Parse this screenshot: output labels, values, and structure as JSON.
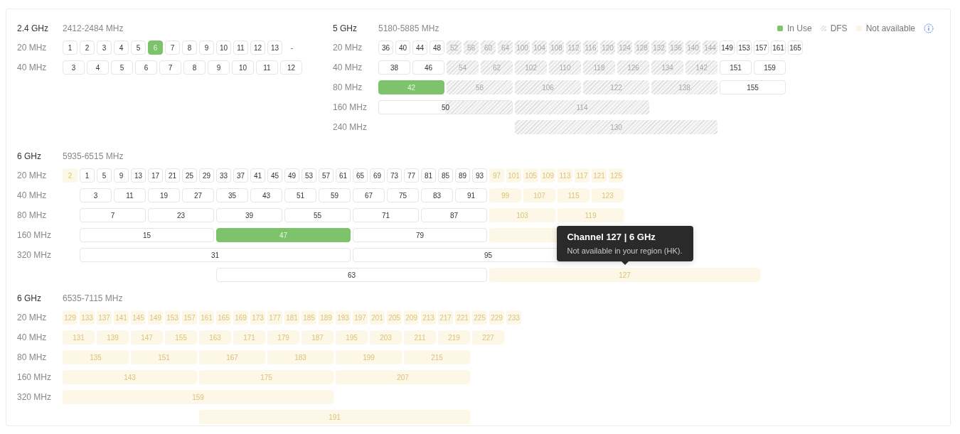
{
  "legend": [
    {
      "kind": "in_use",
      "label": "In Use"
    },
    {
      "kind": "dfs",
      "label": "DFS"
    },
    {
      "kind": "unavailable",
      "label": "Not available"
    }
  ],
  "bands": [
    {
      "name": "2.4 GHz",
      "range": "2412-2484 MHz",
      "kind": "sequential",
      "rows": [
        {
          "label": "20 MHz",
          "lines": [
            [
              {
                "ch": "1",
                "kind": "available"
              },
              {
                "ch": "2",
                "kind": "available"
              },
              {
                "ch": "3",
                "kind": "available"
              },
              {
                "ch": "4",
                "kind": "available"
              },
              {
                "ch": "5",
                "kind": "available"
              },
              {
                "ch": "6",
                "kind": "in_use"
              },
              {
                "ch": "7",
                "kind": "available"
              },
              {
                "ch": "8",
                "kind": "available"
              },
              {
                "ch": "9",
                "kind": "available"
              },
              {
                "ch": "10",
                "kind": "available"
              },
              {
                "ch": "11",
                "kind": "available"
              },
              {
                "ch": "12",
                "kind": "available"
              },
              {
                "ch": "13",
                "kind": "available"
              },
              {
                "ch": "-",
                "kind": "blank"
              }
            ]
          ]
        },
        {
          "label": "40 MHz",
          "lines": [
            [
              {
                "ch": "3",
                "kind": "available"
              },
              {
                "ch": "4",
                "kind": "available"
              },
              {
                "ch": "5",
                "kind": "available"
              },
              {
                "ch": "6",
                "kind": "available"
              },
              {
                "ch": "7",
                "kind": "available"
              },
              {
                "ch": "8",
                "kind": "available"
              },
              {
                "ch": "9",
                "kind": "available"
              },
              {
                "ch": "10",
                "kind": "available"
              },
              {
                "ch": "11",
                "kind": "available"
              },
              {
                "ch": "12",
                "kind": "available"
              }
            ]
          ]
        }
      ]
    },
    {
      "name": "5 GHz",
      "range": "5180-5885 MHz",
      "kind": "aligned",
      "rows": [
        {
          "label": "20 MHz",
          "lines": [
            [
              {
                "ch": "36",
                "kind": "available"
              },
              {
                "ch": "40",
                "kind": "available"
              },
              {
                "ch": "44",
                "kind": "available"
              },
              {
                "ch": "48",
                "kind": "available"
              },
              {
                "ch": "52",
                "kind": "dfs"
              },
              {
                "ch": "56",
                "kind": "dfs"
              },
              {
                "ch": "60",
                "kind": "dfs"
              },
              {
                "ch": "64",
                "kind": "dfs"
              },
              {
                "ch": "100",
                "kind": "dfs"
              },
              {
                "ch": "104",
                "kind": "dfs"
              },
              {
                "ch": "108",
                "kind": "dfs"
              },
              {
                "ch": "112",
                "kind": "dfs"
              },
              {
                "ch": "116",
                "kind": "dfs"
              },
              {
                "ch": "120",
                "kind": "dfs"
              },
              {
                "ch": "124",
                "kind": "dfs"
              },
              {
                "ch": "128",
                "kind": "dfs"
              },
              {
                "ch": "132",
                "kind": "dfs"
              },
              {
                "ch": "136",
                "kind": "dfs"
              },
              {
                "ch": "140",
                "kind": "dfs"
              },
              {
                "ch": "144",
                "kind": "dfs"
              },
              {
                "ch": "149",
                "kind": "available"
              },
              {
                "ch": "153",
                "kind": "available"
              },
              {
                "ch": "157",
                "kind": "available"
              },
              {
                "ch": "161",
                "kind": "available"
              },
              {
                "ch": "165",
                "kind": "available"
              }
            ]
          ]
        },
        {
          "label": "40 MHz",
          "lines": [
            [
              {
                "ch": "38",
                "kind": "available"
              },
              {
                "ch": "46",
                "kind": "available"
              },
              {
                "ch": "54",
                "kind": "dfs"
              },
              {
                "ch": "62",
                "kind": "dfs"
              },
              {
                "ch": "102",
                "kind": "dfs"
              },
              {
                "ch": "110",
                "kind": "dfs"
              },
              {
                "ch": "118",
                "kind": "dfs"
              },
              {
                "ch": "126",
                "kind": "dfs"
              },
              {
                "ch": "134",
                "kind": "dfs"
              },
              {
                "ch": "142",
                "kind": "dfs"
              },
              {
                "ch": "151",
                "kind": "available"
              },
              {
                "ch": "159",
                "kind": "available"
              }
            ]
          ]
        },
        {
          "label": "80 MHz",
          "lines": [
            [
              {
                "ch": "42",
                "kind": "in_use"
              },
              {
                "ch": "58",
                "kind": "dfs"
              },
              {
                "ch": "106",
                "kind": "dfs"
              },
              {
                "ch": "122",
                "kind": "dfs"
              },
              {
                "ch": "138",
                "kind": "dfs"
              },
              {
                "ch": "155",
                "kind": "available"
              }
            ]
          ]
        },
        {
          "label": "160 MHz",
          "lines": [
            [
              {
                "ch": "50",
                "kind": "partial_dfs"
              },
              {
                "ch": "114",
                "kind": "dfs"
              }
            ]
          ]
        },
        {
          "label": "240 MHz",
          "lines": [
            [
              {
                "ch": "130",
                "kind": "dfs"
              }
            ]
          ]
        }
      ]
    },
    {
      "name": "6 GHz",
      "range": "5935-6515 MHz",
      "kind": "aligned",
      "rows": [
        {
          "label": "20 MHz",
          "lines": [
            [
              {
                "ch": "2",
                "kind": "unavailable"
              },
              {
                "ch": "1",
                "kind": "available"
              },
              {
                "ch": "5",
                "kind": "available"
              },
              {
                "ch": "9",
                "kind": "available"
              },
              {
                "ch": "13",
                "kind": "available"
              },
              {
                "ch": "17",
                "kind": "available"
              },
              {
                "ch": "21",
                "kind": "available"
              },
              {
                "ch": "25",
                "kind": "available"
              },
              {
                "ch": "29",
                "kind": "available"
              },
              {
                "ch": "33",
                "kind": "available"
              },
              {
                "ch": "37",
                "kind": "available"
              },
              {
                "ch": "41",
                "kind": "available"
              },
              {
                "ch": "45",
                "kind": "available"
              },
              {
                "ch": "49",
                "kind": "available"
              },
              {
                "ch": "53",
                "kind": "available"
              },
              {
                "ch": "57",
                "kind": "available"
              },
              {
                "ch": "61",
                "kind": "available"
              },
              {
                "ch": "65",
                "kind": "available"
              },
              {
                "ch": "69",
                "kind": "available"
              },
              {
                "ch": "73",
                "kind": "available"
              },
              {
                "ch": "77",
                "kind": "available"
              },
              {
                "ch": "81",
                "kind": "available"
              },
              {
                "ch": "85",
                "kind": "available"
              },
              {
                "ch": "89",
                "kind": "available"
              },
              {
                "ch": "93",
                "kind": "available"
              },
              {
                "ch": "97",
                "kind": "unavailable"
              },
              {
                "ch": "101",
                "kind": "unavailable"
              },
              {
                "ch": "105",
                "kind": "unavailable"
              },
              {
                "ch": "109",
                "kind": "unavailable"
              },
              {
                "ch": "113",
                "kind": "unavailable"
              },
              {
                "ch": "117",
                "kind": "unavailable"
              },
              {
                "ch": "121",
                "kind": "unavailable"
              },
              {
                "ch": "125",
                "kind": "unavailable"
              }
            ]
          ]
        },
        {
          "label": "40 MHz",
          "lines": [
            [
              {
                "ch": "3",
                "kind": "available"
              },
              {
                "ch": "11",
                "kind": "available"
              },
              {
                "ch": "19",
                "kind": "available"
              },
              {
                "ch": "27",
                "kind": "available"
              },
              {
                "ch": "35",
                "kind": "available"
              },
              {
                "ch": "43",
                "kind": "available"
              },
              {
                "ch": "51",
                "kind": "available"
              },
              {
                "ch": "59",
                "kind": "available"
              },
              {
                "ch": "67",
                "kind": "available"
              },
              {
                "ch": "75",
                "kind": "available"
              },
              {
                "ch": "83",
                "kind": "available"
              },
              {
                "ch": "91",
                "kind": "available"
              },
              {
                "ch": "99",
                "kind": "unavailable"
              },
              {
                "ch": "107",
                "kind": "unavailable"
              },
              {
                "ch": "115",
                "kind": "unavailable"
              },
              {
                "ch": "123",
                "kind": "unavailable"
              }
            ]
          ]
        },
        {
          "label": "80 MHz",
          "lines": [
            [
              {
                "ch": "7",
                "kind": "available"
              },
              {
                "ch": "23",
                "kind": "available"
              },
              {
                "ch": "39",
                "kind": "available"
              },
              {
                "ch": "55",
                "kind": "available"
              },
              {
                "ch": "71",
                "kind": "available"
              },
              {
                "ch": "87",
                "kind": "available"
              },
              {
                "ch": "103",
                "kind": "unavailable"
              },
              {
                "ch": "119",
                "kind": "unavailable"
              }
            ]
          ]
        },
        {
          "label": "160 MHz",
          "lines": [
            [
              {
                "ch": "15",
                "kind": "available"
              },
              {
                "ch": "47",
                "kind": "in_use"
              },
              {
                "ch": "79",
                "kind": "available"
              },
              {
                "kind": "unavailable"
              }
            ]
          ]
        },
        {
          "label": "320 MHz",
          "lines": [
            [
              {
                "ch": "31",
                "kind": "available"
              },
              {
                "ch": "95",
                "kind": "available"
              }
            ],
            [
              {
                "ch": "63",
                "kind": "available"
              },
              {
                "ch": "127",
                "kind": "unavailable",
                "tooltip": {
                  "title": "Channel 127 | 6 GHz",
                  "text": "Not available in your region (HK)."
                }
              }
            ]
          ]
        }
      ]
    },
    {
      "name": "6 GHz",
      "range": "6535-7115 MHz",
      "kind": "aligned",
      "rows": [
        {
          "label": "20 MHz",
          "lines": [
            [
              {
                "ch": "129",
                "kind": "unavailable"
              },
              {
                "ch": "133",
                "kind": "unavailable"
              },
              {
                "ch": "137",
                "kind": "unavailable"
              },
              {
                "ch": "141",
                "kind": "unavailable"
              },
              {
                "ch": "145",
                "kind": "unavailable"
              },
              {
                "ch": "149",
                "kind": "unavailable"
              },
              {
                "ch": "153",
                "kind": "unavailable"
              },
              {
                "ch": "157",
                "kind": "unavailable"
              },
              {
                "ch": "161",
                "kind": "unavailable"
              },
              {
                "ch": "165",
                "kind": "unavailable"
              },
              {
                "ch": "169",
                "kind": "unavailable"
              },
              {
                "ch": "173",
                "kind": "unavailable"
              },
              {
                "ch": "177",
                "kind": "unavailable"
              },
              {
                "ch": "181",
                "kind": "unavailable"
              },
              {
                "ch": "185",
                "kind": "unavailable"
              },
              {
                "ch": "189",
                "kind": "unavailable"
              },
              {
                "ch": "193",
                "kind": "unavailable"
              },
              {
                "ch": "197",
                "kind": "unavailable"
              },
              {
                "ch": "201",
                "kind": "unavailable"
              },
              {
                "ch": "205",
                "kind": "unavailable"
              },
              {
                "ch": "209",
                "kind": "unavailable"
              },
              {
                "ch": "213",
                "kind": "unavailable"
              },
              {
                "ch": "217",
                "kind": "unavailable"
              },
              {
                "ch": "221",
                "kind": "unavailable"
              },
              {
                "ch": "225",
                "kind": "unavailable"
              },
              {
                "ch": "229",
                "kind": "unavailable"
              },
              {
                "ch": "233",
                "kind": "unavailable"
              }
            ]
          ]
        },
        {
          "label": "40 MHz",
          "lines": [
            [
              {
                "ch": "131",
                "kind": "unavailable"
              },
              {
                "ch": "139",
                "kind": "unavailable"
              },
              {
                "ch": "147",
                "kind": "unavailable"
              },
              {
                "ch": "155",
                "kind": "unavailable"
              },
              {
                "ch": "163",
                "kind": "unavailable"
              },
              {
                "ch": "171",
                "kind": "unavailable"
              },
              {
                "ch": "179",
                "kind": "unavailable"
              },
              {
                "ch": "187",
                "kind": "unavailable"
              },
              {
                "ch": "195",
                "kind": "unavailable"
              },
              {
                "ch": "203",
                "kind": "unavailable"
              },
              {
                "ch": "211",
                "kind": "unavailable"
              },
              {
                "ch": "219",
                "kind": "unavailable"
              },
              {
                "ch": "227",
                "kind": "unavailable"
              }
            ]
          ]
        },
        {
          "label": "80 MHz",
          "lines": [
            [
              {
                "ch": "135",
                "kind": "unavailable"
              },
              {
                "ch": "151",
                "kind": "unavailable"
              },
              {
                "ch": "167",
                "kind": "unavailable"
              },
              {
                "ch": "183",
                "kind": "unavailable"
              },
              {
                "ch": "199",
                "kind": "unavailable"
              },
              {
                "ch": "215",
                "kind": "unavailable"
              }
            ]
          ]
        },
        {
          "label": "160 MHz",
          "lines": [
            [
              {
                "ch": "143",
                "kind": "unavailable"
              },
              {
                "ch": "175",
                "kind": "unavailable"
              },
              {
                "ch": "207",
                "kind": "unavailable"
              }
            ]
          ]
        },
        {
          "label": "320 MHz",
          "lines": [
            [
              {
                "ch": "159",
                "kind": "unavailable"
              }
            ],
            [
              {
                "ch": "191",
                "kind": "unavailable"
              }
            ]
          ]
        }
      ]
    }
  ]
}
